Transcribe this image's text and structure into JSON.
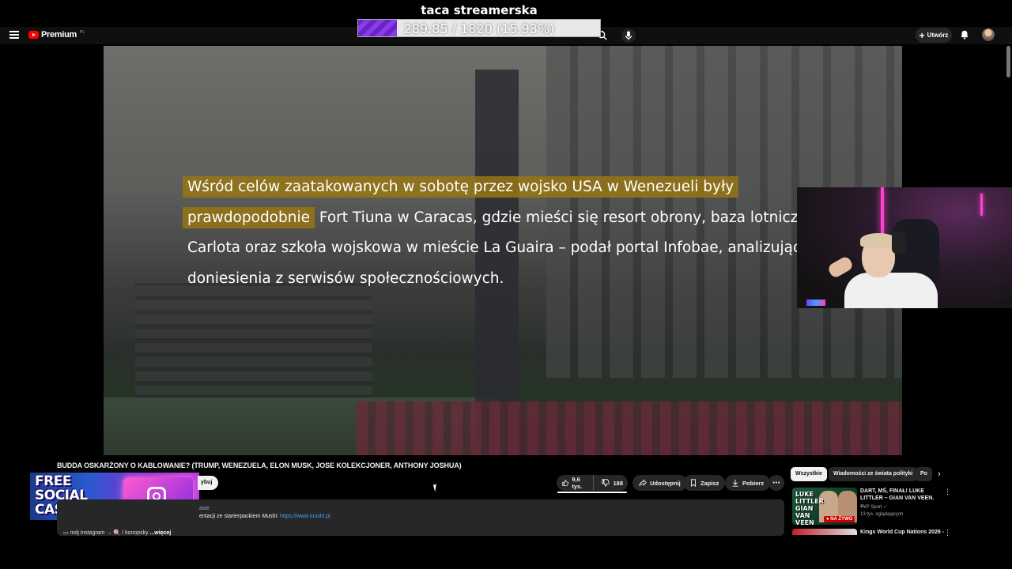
{
  "stream_goal": {
    "title": "taca streamerska",
    "progress_text": "289.85 / 1820 (15.93%)",
    "current": 289.85,
    "target": 1820,
    "percent": 15.93,
    "bar_color": "#7a30d6"
  },
  "header": {
    "logo_text": "Premium",
    "logo_region": "PL",
    "create_label": "Utwórz",
    "icons": [
      "menu-icon",
      "search-icon",
      "mic-icon",
      "plus-icon",
      "bell-icon"
    ]
  },
  "subtitles": {
    "line1": "Wśród celów zaatakowanych w sobotę przez wojsko USA w Wenezueli były",
    "line2_hl": "prawdopodobnie",
    "line2_rest": " Fort Tiuna w Caracas, gdzie mieści się resort obrony, baza lotnicza La",
    "line3": "Carlota oraz szkoła wojskowa w mieście La Guaira – podał portal Infobae, analizując",
    "line4": "doniesienia z serwisów społecznościowych.",
    "highlight_color": "#96761a"
  },
  "video": {
    "title": "BUDDA OSKARŻONY O KABLOWANIE? (TRUMP, WENEZUELA, ELON MUSK, JOSE KOLEKCJONER, ANTHONY JOSHUA)",
    "subscribe_label": "ybuj",
    "likes": "9,6 tys.",
    "dislikes": "188",
    "share_label": "Udostępnij",
    "save_label": "Zapisz",
    "download_label": "Pobierz",
    "more_label": "⋯"
  },
  "ad": {
    "line1": "FREE",
    "line2": "SOCIAL",
    "line3": "CASES"
  },
  "description": {
    "views_fragment": "asie",
    "line2_text": "entacji ze starterpackiem Mushi: ",
    "line2_link": "https://www.mushi.pl",
    "line3_text": "▭ mój instagram → 🍭 / konopsky",
    "more_label": " ...więcej"
  },
  "sidebar": {
    "chips": [
      "Wszystkie",
      "Wiadomości ze świata polityki",
      "Po"
    ],
    "recommendations": [
      {
        "thumb_text": "LUKE LITTLER GIAN VAN VEEN",
        "live_badge": "● NA ŻYWO",
        "title": "DART, MŚ, FINAŁ! LUKE LITTLER – GIAN VAN VEEN. ...",
        "channel": "TVP Sport ✓",
        "views": "13 tys. oglądających"
      },
      {
        "title": "Kings World Cup Nations 2026 -"
      }
    ]
  }
}
